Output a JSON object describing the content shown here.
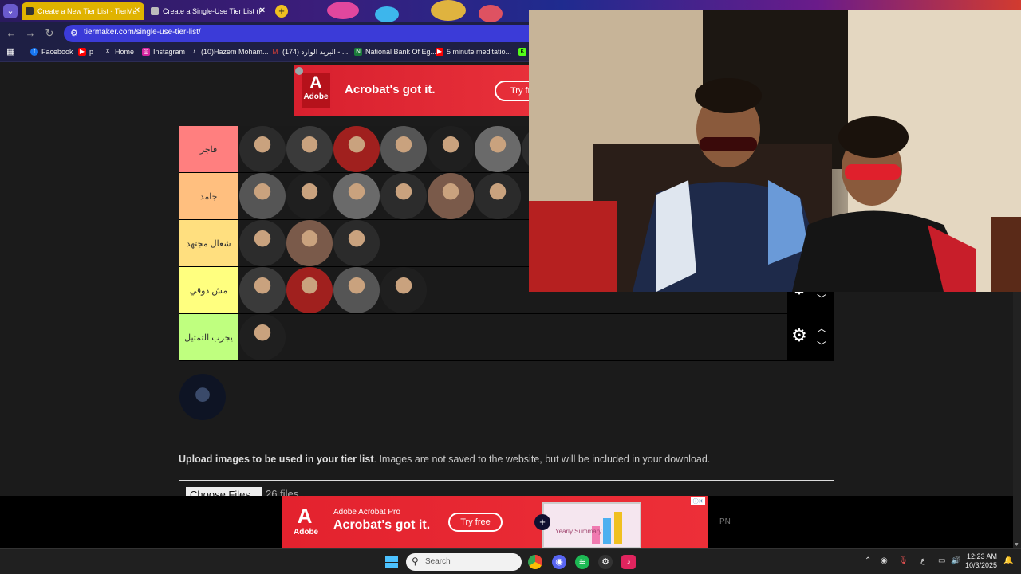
{
  "browser": {
    "tabs": [
      {
        "title": "Create a New Tier List - TierMa",
        "active": true
      },
      {
        "title": "Create a Single-Use Tier List (P",
        "active": false
      }
    ],
    "url": "tiermaker.com/single-use-tier-list/",
    "bookmarks": [
      {
        "label": "Facebook",
        "icon": "facebook-icon",
        "color": "#1877f2",
        "glyph": "f"
      },
      {
        "label": "p",
        "icon": "youtube-icon",
        "color": "#ff0000",
        "glyph": "▶"
      },
      {
        "label": "Home",
        "icon": "x-icon",
        "color": "#000000",
        "glyph": "X"
      },
      {
        "label": "Instagram",
        "icon": "instagram-icon",
        "color": "#d6249f",
        "glyph": "◎"
      },
      {
        "label": "(10)Hazem Moham...",
        "icon": "tiktok-icon",
        "color": "#000000",
        "glyph": "♪"
      },
      {
        "label": "(174) البريد الوارد - ...",
        "icon": "gmail-icon",
        "color": "#ea4335",
        "glyph": "M"
      },
      {
        "label": "National Bank Of Eg...",
        "icon": "nbe-icon",
        "color": "#1a7a3a",
        "glyph": "N"
      },
      {
        "label": "5 minute meditatio...",
        "icon": "youtube-icon",
        "color": "#ff0000",
        "glyph": "▶"
      }
    ]
  },
  "top_ad": {
    "brand": "Adobe",
    "slogan": "Acrobat's got it.",
    "cta": "Try fre"
  },
  "tiers": [
    {
      "label": "فاجر",
      "color": "#ff7f7f",
      "items": 7
    },
    {
      "label": "جامد",
      "color": "#ffbf7f",
      "items": 6
    },
    {
      "label": "شغال مجتهد",
      "color": "#ffdf7f",
      "items": 3
    },
    {
      "label": "مش ذوقي",
      "color": "#ffff7f",
      "items": 4
    },
    {
      "label": "يجرب التمثيل",
      "color": "#bfff7f",
      "items": 1
    }
  ],
  "bank_items": 1,
  "upload": {
    "bold": "Upload images to be used in your tier list",
    "rest": ". Images are not saved to the website, but will be included in your download.",
    "button": "Choose Files",
    "count": "26 files"
  },
  "bottom_ad": {
    "brand": "Adobe",
    "product": "Adobe Acrobat Pro",
    "slogan": "Acrobat's got it.",
    "cta": "Try free",
    "screen_label": "Yearly Summary"
  },
  "side_text": "PN",
  "taskbar": {
    "search_placeholder": "Search",
    "lang": "ع",
    "time": "12:23 AM",
    "date": "10/3/2025"
  }
}
